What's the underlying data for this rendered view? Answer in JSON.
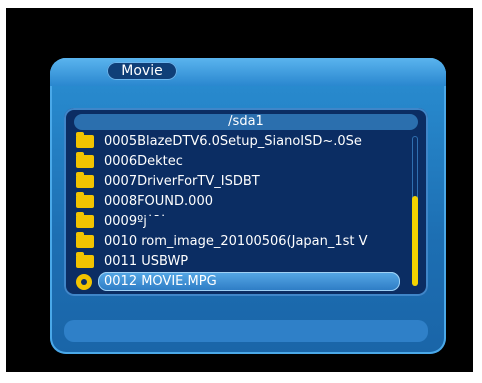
{
  "title": "Movie",
  "path": "/sda1",
  "items": [
    {
      "label": "0005BlazeDTV6.0Setup_SianoISD~.0Se",
      "icon": "folder-icon"
    },
    {
      "label": "0006Dektec",
      "icon": "folder-icon"
    },
    {
      "label": "0007DriverForTV_ISDBT",
      "icon": "folder-icon"
    },
    {
      "label": "0008FOUND.000",
      "icon": "folder-icon"
    },
    {
      "label": "0009ºj˙¯˙",
      "icon": "folder-icon"
    },
    {
      "label": "0010 rom_image_20100506(Japan_1st V",
      "icon": "folder-icon"
    },
    {
      "label": "0011 USBWP",
      "icon": "folder-icon"
    },
    {
      "label": "0012 MOVIE.MPG",
      "icon": "movie-file-icon",
      "selected": true
    }
  ],
  "scroll": {
    "start_fraction": 0.4,
    "end_fraction": 1.0
  },
  "colors": {
    "accent": "#2a8fd3",
    "highlight": "#f2c400",
    "list_bg": "#0b2d63"
  }
}
